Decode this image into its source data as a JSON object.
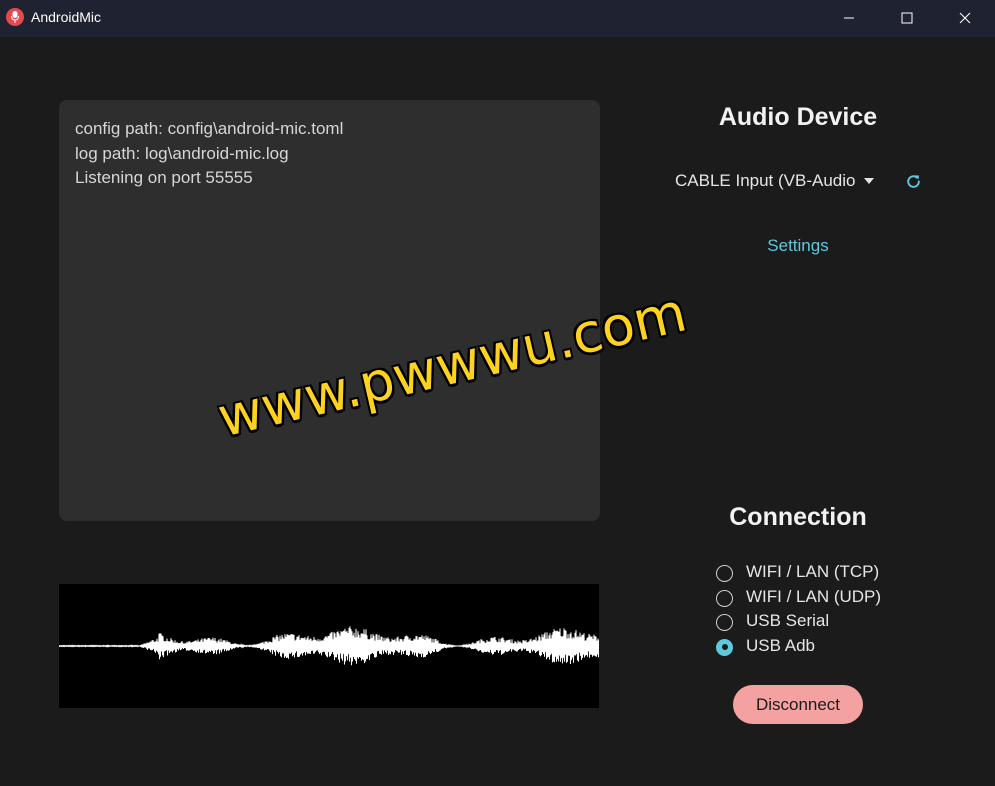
{
  "window": {
    "title": "AndroidMic",
    "controls": {
      "minimize": "minimize-icon",
      "maximize": "maximize-icon",
      "close": "close-icon"
    }
  },
  "log": {
    "lines": [
      "config path: config\\android-mic.toml",
      "log path: log\\android-mic.log",
      "Listening on port 55555"
    ]
  },
  "audio_device": {
    "heading": "Audio Device",
    "selected": "CABLE Input (VB-Audio",
    "settings_link": "Settings"
  },
  "connection": {
    "heading": "Connection",
    "options": [
      {
        "label": "WIFI / LAN (TCP)",
        "checked": false
      },
      {
        "label": "WIFI / LAN (UDP)",
        "checked": false
      },
      {
        "label": "USB Serial",
        "checked": false
      },
      {
        "label": "USB Adb",
        "checked": true
      }
    ],
    "disconnect_label": "Disconnect"
  },
  "watermark": "www.pwwwu.com",
  "colors": {
    "background": "#1b1b1b",
    "panel": "#2e2e2e",
    "accent": "#5fc8dc",
    "disconnect": "#f4a1a1",
    "titlebar": "#1f2230"
  }
}
